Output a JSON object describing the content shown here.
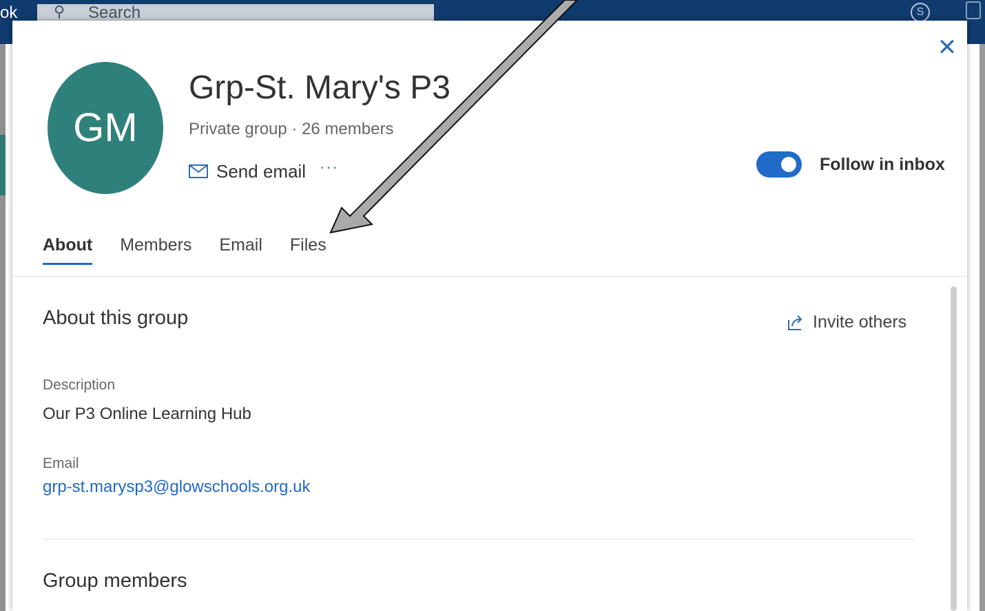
{
  "background": {
    "app_label": "ok",
    "search_label": "Search",
    "skype_label": "S",
    "brand_color": "#0f3b6e"
  },
  "dialog": {
    "avatar_initials": "GM",
    "avatar_color": "#2e807a",
    "title": "Grp-St. Mary's P3",
    "meta": "Private group · 26 members",
    "send_email_label": "Send email",
    "more_label": "···",
    "follow_label": "Follow in inbox",
    "follow_enabled": true,
    "close_icon": "close-icon",
    "tabs": [
      {
        "label": "About",
        "active": true
      },
      {
        "label": "Members",
        "active": false
      },
      {
        "label": "Email",
        "active": false
      },
      {
        "label": "Files",
        "active": false
      }
    ],
    "about": {
      "heading": "About this group",
      "invite_label": "Invite others",
      "description_label": "Description",
      "description_value": "Our P3 Online Learning Hub",
      "email_label": "Email",
      "email_value": "grp-st.marysp3@glowschools.org.uk"
    },
    "members_heading": "Group members"
  },
  "accent_color": "#1f6bc7"
}
